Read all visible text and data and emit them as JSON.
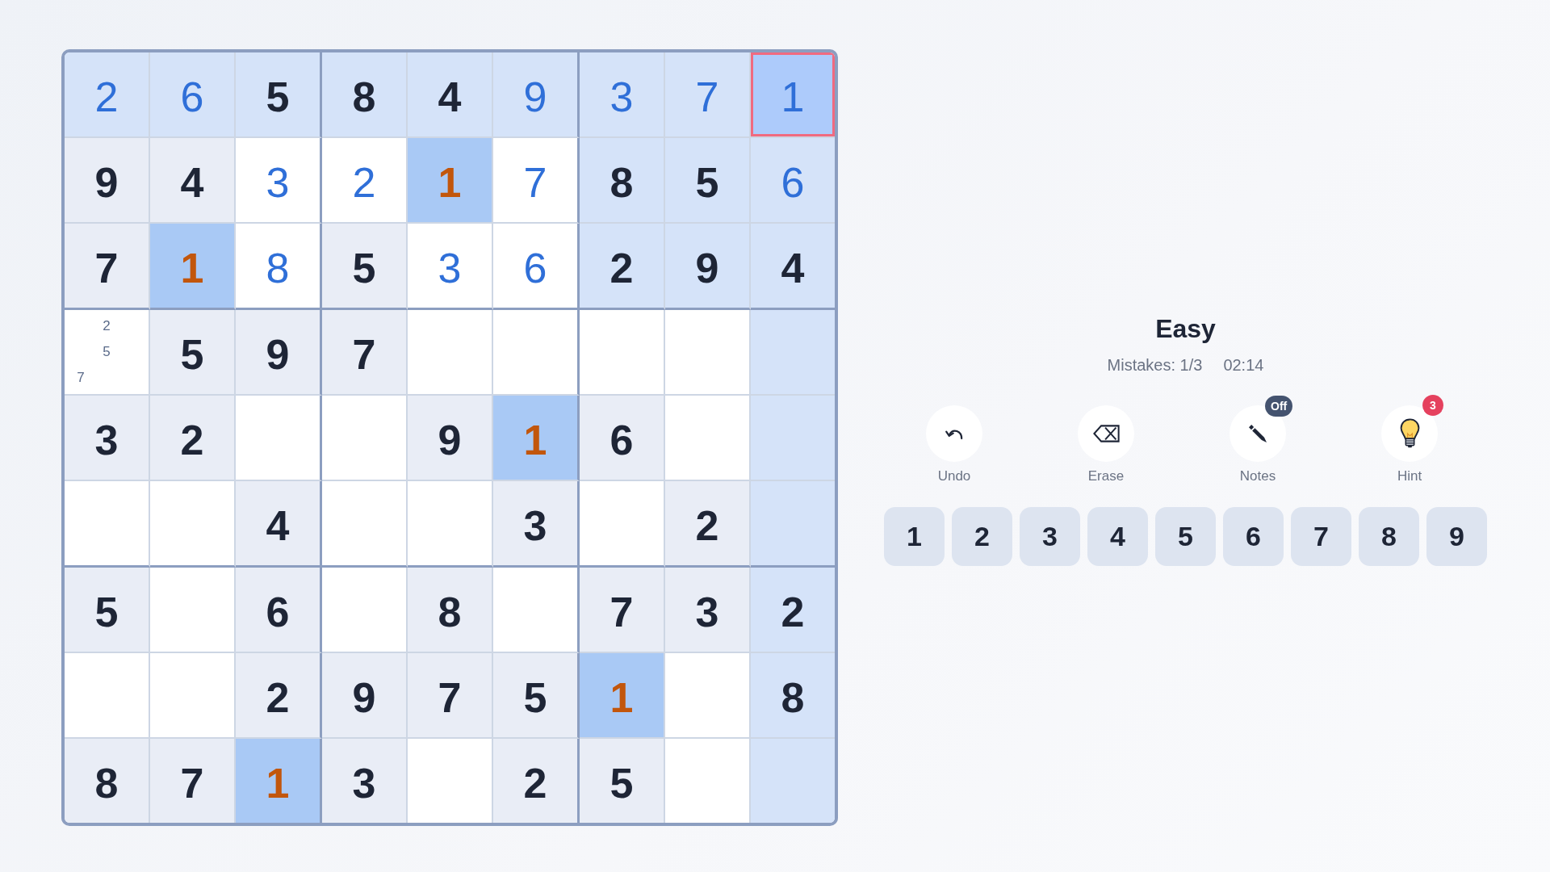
{
  "board": {
    "rows": [
      {
        "cells": [
          {
            "value": "2",
            "kind": "entered",
            "related": true,
            "same_digit": false,
            "selected": false
          },
          {
            "value": "6",
            "kind": "entered",
            "related": true,
            "same_digit": false,
            "selected": false
          },
          {
            "value": "5",
            "kind": "given",
            "related": true,
            "same_digit": false,
            "selected": false
          },
          {
            "value": "8",
            "kind": "given",
            "related": true,
            "same_digit": false,
            "selected": false
          },
          {
            "value": "4",
            "kind": "given",
            "related": true,
            "same_digit": false,
            "selected": false
          },
          {
            "value": "9",
            "kind": "entered",
            "related": true,
            "same_digit": false,
            "selected": false
          },
          {
            "value": "3",
            "kind": "entered",
            "related": true,
            "same_digit": false,
            "selected": false
          },
          {
            "value": "7",
            "kind": "entered",
            "related": true,
            "same_digit": false,
            "selected": false
          },
          {
            "value": "1",
            "kind": "entered",
            "related": true,
            "same_digit": true,
            "selected": true
          }
        ]
      },
      {
        "cells": [
          {
            "value": "9",
            "kind": "given",
            "related": false,
            "same_digit": false,
            "selected": false
          },
          {
            "value": "4",
            "kind": "given",
            "related": false,
            "same_digit": false,
            "selected": false
          },
          {
            "value": "3",
            "kind": "entered",
            "related": false,
            "same_digit": false,
            "selected": false
          },
          {
            "value": "2",
            "kind": "entered",
            "related": false,
            "same_digit": false,
            "selected": false
          },
          {
            "value": "1",
            "kind": "given",
            "related": false,
            "same_digit": true,
            "selected": false
          },
          {
            "value": "7",
            "kind": "entered",
            "related": false,
            "same_digit": false,
            "selected": false
          },
          {
            "value": "8",
            "kind": "given",
            "related": true,
            "same_digit": false,
            "selected": false
          },
          {
            "value": "5",
            "kind": "given",
            "related": true,
            "same_digit": false,
            "selected": false
          },
          {
            "value": "6",
            "kind": "entered",
            "related": true,
            "same_digit": false,
            "selected": false
          }
        ]
      },
      {
        "cells": [
          {
            "value": "7",
            "kind": "given",
            "related": false,
            "same_digit": false,
            "selected": false
          },
          {
            "value": "1",
            "kind": "given",
            "related": false,
            "same_digit": true,
            "selected": false
          },
          {
            "value": "8",
            "kind": "entered",
            "related": false,
            "same_digit": false,
            "selected": false
          },
          {
            "value": "5",
            "kind": "given",
            "related": false,
            "same_digit": false,
            "selected": false
          },
          {
            "value": "3",
            "kind": "entered",
            "related": false,
            "same_digit": false,
            "selected": false
          },
          {
            "value": "6",
            "kind": "entered",
            "related": false,
            "same_digit": false,
            "selected": false
          },
          {
            "value": "2",
            "kind": "given",
            "related": true,
            "same_digit": false,
            "selected": false
          },
          {
            "value": "9",
            "kind": "given",
            "related": true,
            "same_digit": false,
            "selected": false
          },
          {
            "value": "4",
            "kind": "given",
            "related": true,
            "same_digit": false,
            "selected": false
          }
        ]
      },
      {
        "cells": [
          {
            "kind": "notes",
            "related": false,
            "same_digit": false,
            "selected": false,
            "note_rows": [
              {
                "items": [
                  {
                    "text": "2",
                    "kind": "center"
                  }
                ]
              },
              {
                "items": [
                  {
                    "text": "5",
                    "kind": "center"
                  }
                ]
              },
              {
                "items": [
                  {
                    "text": "7",
                    "kind": "left"
                  }
                ]
              }
            ]
          },
          {
            "value": "5",
            "kind": "given",
            "related": false,
            "same_digit": false,
            "selected": false
          },
          {
            "value": "9",
            "kind": "given",
            "related": false,
            "same_digit": false,
            "selected": false
          },
          {
            "value": "7",
            "kind": "given",
            "related": false,
            "same_digit": false,
            "selected": false
          },
          {
            "kind": "empty",
            "related": false,
            "same_digit": false,
            "selected": false
          },
          {
            "kind": "empty",
            "related": false,
            "same_digit": false,
            "selected": false
          },
          {
            "kind": "empty",
            "related": false,
            "same_digit": false,
            "selected": false
          },
          {
            "kind": "empty",
            "related": false,
            "same_digit": false,
            "selected": false
          },
          {
            "kind": "empty",
            "related": true,
            "same_digit": false,
            "selected": false
          }
        ]
      },
      {
        "cells": [
          {
            "value": "3",
            "kind": "given",
            "related": false,
            "same_digit": false,
            "selected": false
          },
          {
            "value": "2",
            "kind": "given",
            "related": false,
            "same_digit": false,
            "selected": false
          },
          {
            "kind": "empty",
            "related": false,
            "same_digit": false,
            "selected": false
          },
          {
            "kind": "empty",
            "related": false,
            "same_digit": false,
            "selected": false
          },
          {
            "value": "9",
            "kind": "given",
            "related": false,
            "same_digit": false,
            "selected": false
          },
          {
            "value": "1",
            "kind": "given",
            "related": false,
            "same_digit": true,
            "selected": false
          },
          {
            "value": "6",
            "kind": "given",
            "related": false,
            "same_digit": false,
            "selected": false
          },
          {
            "kind": "empty",
            "related": false,
            "same_digit": false,
            "selected": false
          },
          {
            "kind": "empty",
            "related": true,
            "same_digit": false,
            "selected": false
          }
        ]
      },
      {
        "cells": [
          {
            "kind": "empty",
            "related": false,
            "same_digit": false,
            "selected": false
          },
          {
            "kind": "empty",
            "related": false,
            "same_digit": false,
            "selected": false
          },
          {
            "value": "4",
            "kind": "given",
            "related": false,
            "same_digit": false,
            "selected": false
          },
          {
            "kind": "empty",
            "related": false,
            "same_digit": false,
            "selected": false
          },
          {
            "kind": "empty",
            "related": false,
            "same_digit": false,
            "selected": false
          },
          {
            "value": "3",
            "kind": "given",
            "related": false,
            "same_digit": false,
            "selected": false
          },
          {
            "kind": "empty",
            "related": false,
            "same_digit": false,
            "selected": false
          },
          {
            "value": "2",
            "kind": "given",
            "related": false,
            "same_digit": false,
            "selected": false
          },
          {
            "kind": "empty",
            "related": true,
            "same_digit": false,
            "selected": false
          }
        ]
      },
      {
        "cells": [
          {
            "value": "5",
            "kind": "given",
            "related": false,
            "same_digit": false,
            "selected": false
          },
          {
            "kind": "empty",
            "related": false,
            "same_digit": false,
            "selected": false
          },
          {
            "value": "6",
            "kind": "given",
            "related": false,
            "same_digit": false,
            "selected": false
          },
          {
            "kind": "empty",
            "related": false,
            "same_digit": false,
            "selected": false
          },
          {
            "value": "8",
            "kind": "given",
            "related": false,
            "same_digit": false,
            "selected": false
          },
          {
            "kind": "empty",
            "related": false,
            "same_digit": false,
            "selected": false
          },
          {
            "value": "7",
            "kind": "given",
            "related": false,
            "same_digit": false,
            "selected": false
          },
          {
            "value": "3",
            "kind": "given",
            "related": false,
            "same_digit": false,
            "selected": false
          },
          {
            "value": "2",
            "kind": "given",
            "related": true,
            "same_digit": false,
            "selected": false
          }
        ]
      },
      {
        "cells": [
          {
            "kind": "empty",
            "related": false,
            "same_digit": false,
            "selected": false
          },
          {
            "kind": "empty",
            "related": false,
            "same_digit": false,
            "selected": false
          },
          {
            "value": "2",
            "kind": "given",
            "related": false,
            "same_digit": false,
            "selected": false
          },
          {
            "value": "9",
            "kind": "given",
            "related": false,
            "same_digit": false,
            "selected": false
          },
          {
            "value": "7",
            "kind": "given",
            "related": false,
            "same_digit": false,
            "selected": false
          },
          {
            "value": "5",
            "kind": "given",
            "related": false,
            "same_digit": false,
            "selected": false
          },
          {
            "value": "1",
            "kind": "given",
            "related": false,
            "same_digit": true,
            "selected": false
          },
          {
            "kind": "empty",
            "related": false,
            "same_digit": false,
            "selected": false
          },
          {
            "value": "8",
            "kind": "given",
            "related": true,
            "same_digit": false,
            "selected": false
          }
        ]
      },
      {
        "cells": [
          {
            "value": "8",
            "kind": "given",
            "related": false,
            "same_digit": false,
            "selected": false
          },
          {
            "value": "7",
            "kind": "given",
            "related": false,
            "same_digit": false,
            "selected": false
          },
          {
            "value": "1",
            "kind": "given",
            "related": false,
            "same_digit": true,
            "selected": false
          },
          {
            "value": "3",
            "kind": "given",
            "related": false,
            "same_digit": false,
            "selected": false
          },
          {
            "kind": "empty",
            "related": false,
            "same_digit": false,
            "selected": false
          },
          {
            "value": "2",
            "kind": "given",
            "related": false,
            "same_digit": false,
            "selected": false
          },
          {
            "value": "5",
            "kind": "given",
            "related": false,
            "same_digit": false,
            "selected": false
          },
          {
            "kind": "empty",
            "related": false,
            "same_digit": false,
            "selected": false
          },
          {
            "kind": "empty",
            "related": true,
            "same_digit": false,
            "selected": false
          }
        ]
      }
    ]
  },
  "panel": {
    "difficulty": "Easy",
    "mistakes": "Mistakes: 1/3",
    "timer": "02:14",
    "controls": [
      {
        "kind": "undo",
        "label": "Undo"
      },
      {
        "kind": "erase",
        "label": "Erase"
      },
      {
        "kind": "notes",
        "label": "Notes",
        "badge": "Off"
      },
      {
        "kind": "hint",
        "label": "Hint",
        "badge": "3"
      }
    ],
    "number_pad": [
      "1",
      "2",
      "3",
      "4",
      "5",
      "6",
      "7",
      "8",
      "9"
    ]
  }
}
